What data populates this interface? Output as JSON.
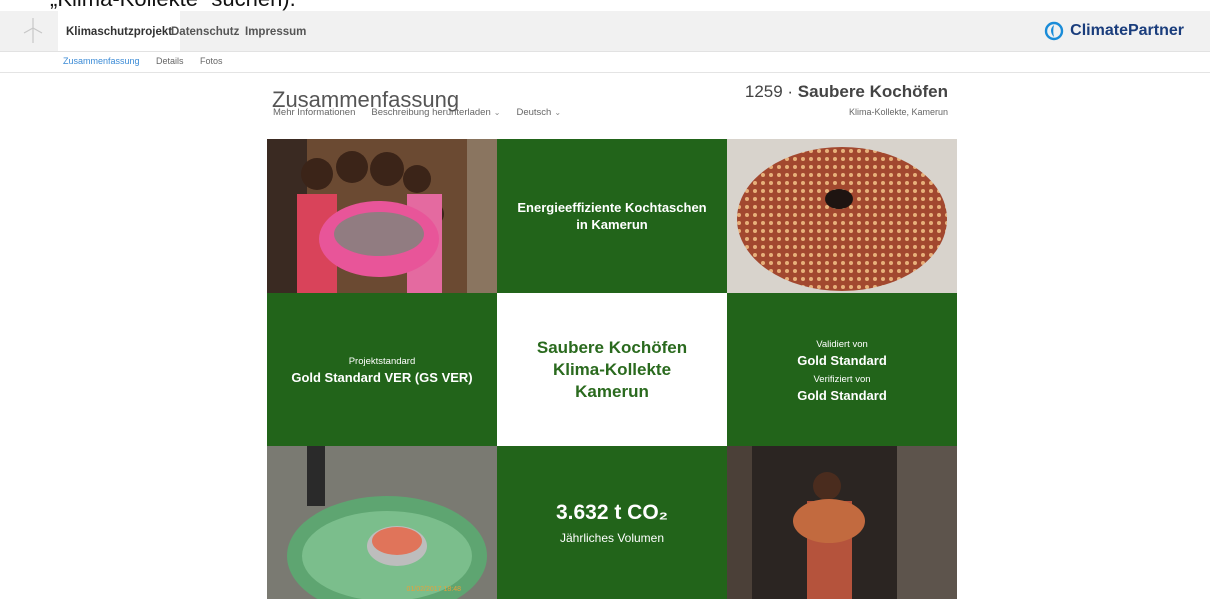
{
  "caption": "„Klima-Kollekte“ suchen).",
  "nav": {
    "tabs": [
      {
        "label": "Klimaschutzprojekt",
        "active": true
      },
      {
        "label": "Datenschutz",
        "active": false
      },
      {
        "label": "Impressum",
        "active": false
      }
    ],
    "brand": "ClimatePartner"
  },
  "subnav": {
    "tabs": [
      {
        "label": "Zusammenfassung",
        "active": true
      },
      {
        "label": "Details",
        "active": false
      },
      {
        "label": "Fotos",
        "active": false
      }
    ]
  },
  "header": {
    "title": "Zusammenfassung",
    "links": {
      "more": "Mehr Informationen",
      "download": "Beschreibung herunterladen",
      "language": "Deutsch"
    },
    "project_number": "1259 ·",
    "project_name": "Saubere Kochöfen",
    "project_sub": "Klima-Kollekte, Kamerun"
  },
  "tiles": {
    "headline": "Energieeffiziente Kochtaschen in Kamerun",
    "standard_label": "Projektstandard",
    "standard_value": "Gold Standard VER (GS VER)",
    "center_line1": "Saubere Kochöfen",
    "center_line2": "Klima-Kollekte",
    "center_line3": "Kamerun",
    "validated_label": "Validiert von",
    "validated_value": "Gold Standard",
    "verified_label": "Verifiziert von",
    "verified_value": "Gold Standard",
    "volume_value": "3.632 t CO₂",
    "volume_label": "Jährliches Volumen",
    "photo_stamp": "01/02/2017 18:48"
  },
  "colors": {
    "green_tile": "#22641a",
    "brand_blue": "#1a3d7c",
    "link_blue": "#3b8bd6"
  },
  "icons": {
    "logo": "wind-turbine-icon",
    "brand": "climatepartner-logo-icon",
    "dropdown": "chevron-down-icon"
  }
}
